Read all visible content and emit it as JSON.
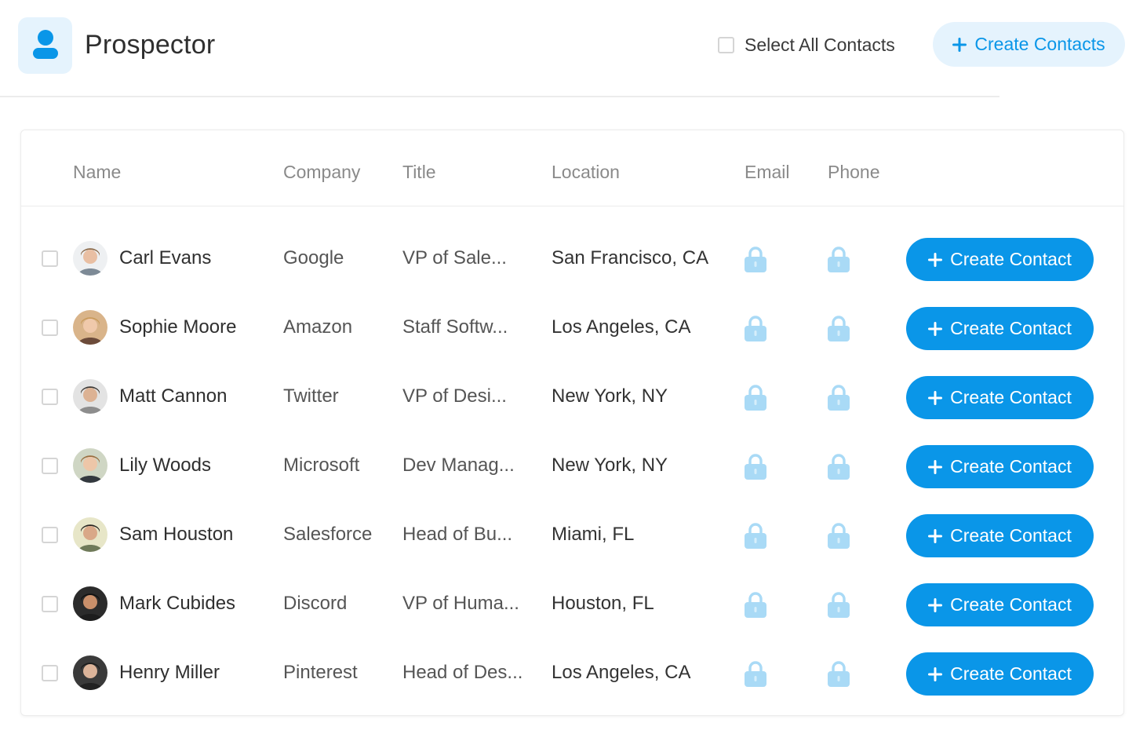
{
  "header": {
    "title": "Prospector",
    "select_all_label": "Select All Contacts",
    "create_contacts_label": "Create Contacts"
  },
  "table": {
    "columns": [
      "Name",
      "Company",
      "Title",
      "Location",
      "Email",
      "Phone"
    ],
    "rows": [
      {
        "name": "Carl Evans",
        "company": "Google",
        "title": "VP of Sale...",
        "location": "San Francisco, CA",
        "button": "Create Contact"
      },
      {
        "name": "Sophie Moore",
        "company": "Amazon",
        "title": "Staff Softw...",
        "location": "Los Angeles, CA",
        "button": "Create Contact"
      },
      {
        "name": "Matt Cannon",
        "company": "Twitter",
        "title": "VP of Desi...",
        "location": "New York, NY",
        "button": "Create Contact"
      },
      {
        "name": "Lily Woods",
        "company": "Microsoft",
        "title": "Dev Manag...",
        "location": "New York, NY",
        "button": "Create Contact"
      },
      {
        "name": "Sam Houston",
        "company": "Salesforce",
        "title": "Head of Bu...",
        "location": "Miami, FL",
        "button": "Create Contact"
      },
      {
        "name": "Mark Cubides",
        "company": "Discord",
        "title": "VP of Huma...",
        "location": "Houston, FL",
        "button": "Create Contact"
      },
      {
        "name": "Henry Miller",
        "company": "Pinterest",
        "title": "Head of Des...",
        "location": "Los Angeles, CA",
        "button": "Create Contact"
      }
    ]
  },
  "icons": {
    "app": "user-icon",
    "lock": "lock-icon",
    "plus": "plus-icon"
  },
  "colors": {
    "accent": "#0a96e8",
    "accent_light": "#e5f3fd",
    "lock": "#a9daf6"
  }
}
